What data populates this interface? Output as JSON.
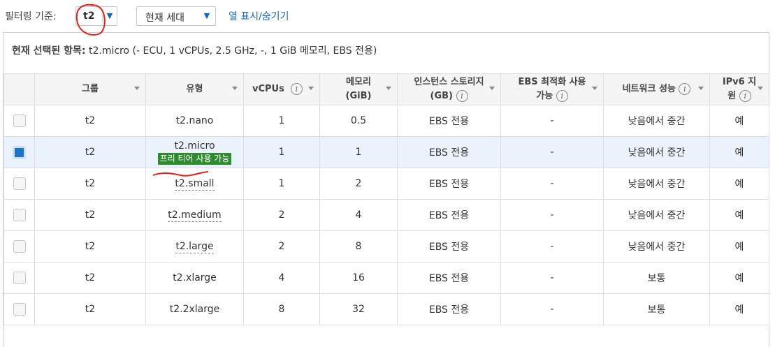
{
  "toolbar": {
    "filter_label": "필터링 기준:",
    "family_value": "t2",
    "generation_value": "현재 세대",
    "toggle_columns": "열 표시/숨기기"
  },
  "current_selection": {
    "label": "현재 선택된 항목:",
    "value": "t2.micro (- ECU, 1 vCPUs, 2.5 GHz, -, 1 GiB 메모리, EBS 전용)"
  },
  "columns": {
    "group": "그룹",
    "type": "유형",
    "vcpus": "vCPUs",
    "memory_l1": "메모리",
    "memory_l2": "(GiB)",
    "storage_l1": "인스턴스 스토리지",
    "storage_l2": "(GB)",
    "ebs_l1": "EBS 최적화 사용",
    "ebs_l2": "가능",
    "network": "네트워크 성능",
    "ipv6_l1": "IPv6 지",
    "ipv6_l2": "원"
  },
  "rows": [
    {
      "group": "t2",
      "type": "t2.nano",
      "vcpus": "1",
      "memory": "0.5",
      "storage": "EBS 전용",
      "ebs": "-",
      "network": "낮음에서 중간",
      "ipv6": "예"
    },
    {
      "group": "t2",
      "type": "t2.micro",
      "badge": "프리 티어 사용 가능",
      "vcpus": "1",
      "memory": "1",
      "storage": "EBS 전용",
      "ebs": "-",
      "network": "낮음에서 중간",
      "ipv6": "예"
    },
    {
      "group": "t2",
      "type": "t2.small",
      "vcpus": "1",
      "memory": "2",
      "storage": "EBS 전용",
      "ebs": "-",
      "network": "낮음에서 중간",
      "ipv6": "예"
    },
    {
      "group": "t2",
      "type": "t2.medium",
      "vcpus": "2",
      "memory": "4",
      "storage": "EBS 전용",
      "ebs": "-",
      "network": "낮음에서 중간",
      "ipv6": "예"
    },
    {
      "group": "t2",
      "type": "t2.large",
      "vcpus": "2",
      "memory": "8",
      "storage": "EBS 전용",
      "ebs": "-",
      "network": "낮음에서 중간",
      "ipv6": "예"
    },
    {
      "group": "t2",
      "type": "t2.xlarge",
      "vcpus": "4",
      "memory": "16",
      "storage": "EBS 전용",
      "ebs": "-",
      "network": "보통",
      "ipv6": "예"
    },
    {
      "group": "t2",
      "type": "t2.2xlarge",
      "vcpus": "8",
      "memory": "32",
      "storage": "EBS 전용",
      "ebs": "-",
      "network": "보통",
      "ipv6": "예"
    }
  ],
  "info_glyph": "i",
  "colors": {
    "accent": "#1166bb",
    "badge": "#2e8b2e",
    "selected_row": "#eaf3fb",
    "annotation": "#e02020"
  }
}
